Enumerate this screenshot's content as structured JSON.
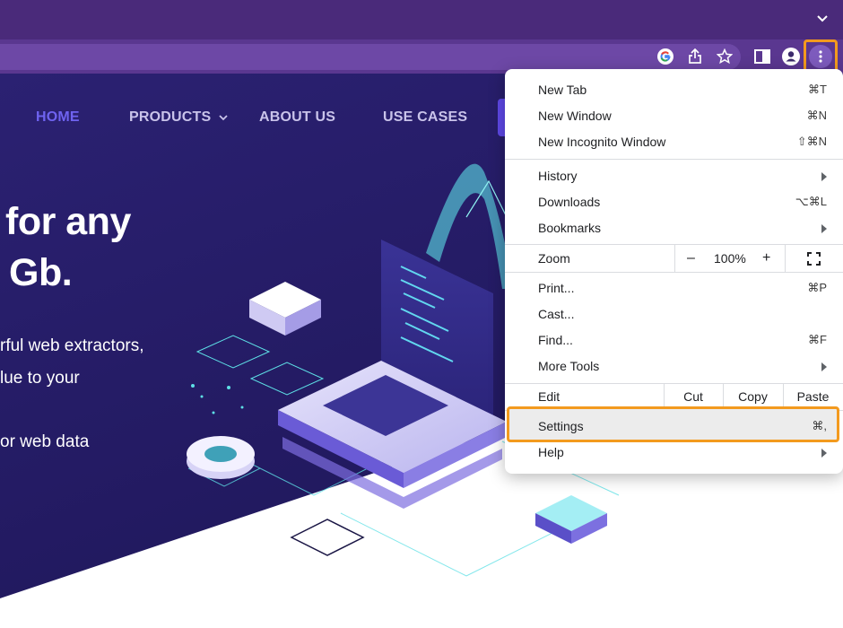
{
  "colors": {
    "tabstrip": "#4a2a7a",
    "toolbar": "#5a3790",
    "hero_bg": "#2a1e6e",
    "highlight": "#f39a1e",
    "nav_active": "#6f63f0"
  },
  "toolbar": {
    "icons": [
      "google-icon",
      "share-icon",
      "bookmark-star-icon",
      "side-panel-icon",
      "profile-icon",
      "kebab-menu-icon"
    ]
  },
  "site": {
    "nav": {
      "home": "HOME",
      "products": "PRODUCTS",
      "about": "ABOUT US",
      "use_cases": "USE CASES"
    },
    "hero": {
      "line1": "for any",
      "line2": "Gb.",
      "text1": "rful web extractors,",
      "text2": "lue to your",
      "text3": "or web data"
    }
  },
  "menu": {
    "new_tab": {
      "label": "New Tab",
      "shortcut": "⌘T"
    },
    "new_window": {
      "label": "New Window",
      "shortcut": "⌘N"
    },
    "new_incognito": {
      "label": "New Incognito Window",
      "shortcut": "⇧⌘N"
    },
    "history": {
      "label": "History"
    },
    "downloads": {
      "label": "Downloads",
      "shortcut": "⌥⌘L"
    },
    "bookmarks": {
      "label": "Bookmarks"
    },
    "zoom": {
      "label": "Zoom",
      "minus": "–",
      "value": "100%",
      "plus": "+",
      "fullscreen_icon": "fullscreen-icon"
    },
    "print": {
      "label": "Print...",
      "shortcut": "⌘P"
    },
    "cast": {
      "label": "Cast..."
    },
    "find": {
      "label": "Find...",
      "shortcut": "⌘F"
    },
    "more_tools": {
      "label": "More Tools"
    },
    "edit": {
      "label": "Edit",
      "cut": "Cut",
      "copy": "Copy",
      "paste": "Paste"
    },
    "settings": {
      "label": "Settings",
      "shortcut": "⌘,"
    },
    "help": {
      "label": "Help"
    }
  }
}
